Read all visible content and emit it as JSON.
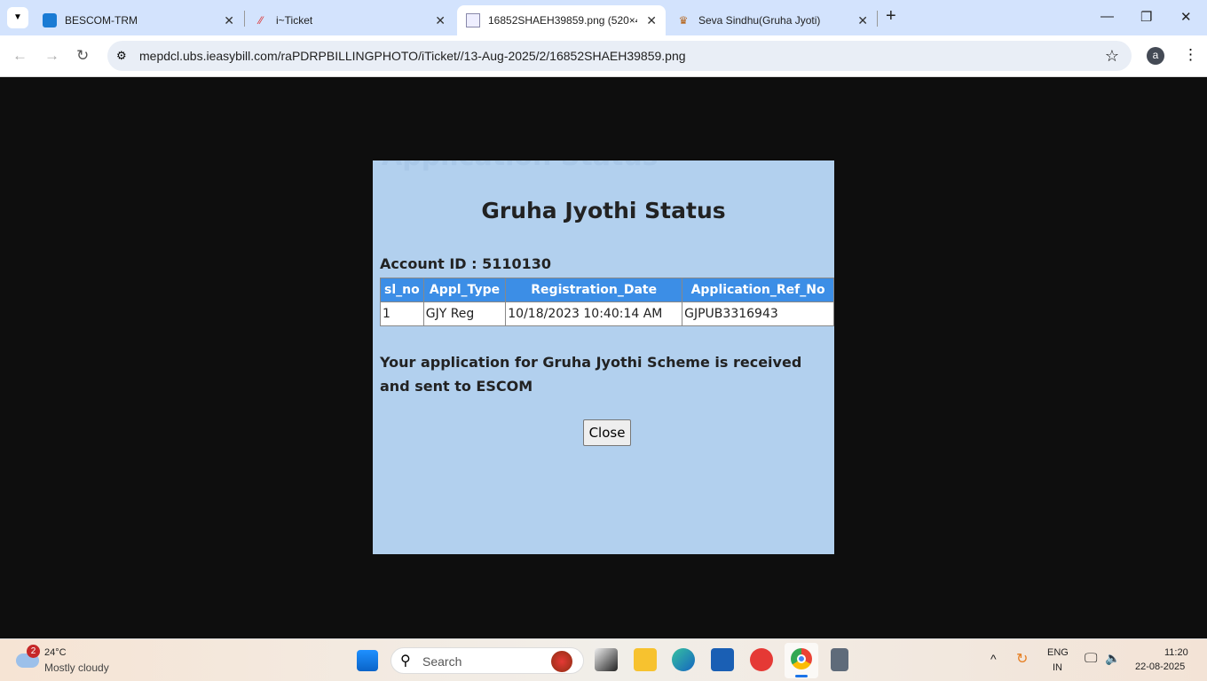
{
  "browser": {
    "tabs": [
      {
        "label": "BESCOM-TRM",
        "icon": "bescom-icon"
      },
      {
        "label": "i~Ticket",
        "icon": "iticket-icon"
      },
      {
        "label": "16852SHAEH39859.png (520×4",
        "icon": "image-file-icon",
        "active": true
      },
      {
        "label": "Seva Sindhu(Gruha Jyoti)",
        "icon": "emblem-icon"
      }
    ],
    "url": "mepdcl.ubs.ieasybill.com/raPDRPBILLINGPHOTO/iTicket//13-Aug-2025/2/16852SHAEH39859.png",
    "profile": "a"
  },
  "page": {
    "ghost_title": "Application Status",
    "title": "Gruha Jyothi Status",
    "account": "Account ID : 5110130",
    "columns": [
      "sl_no",
      "Appl_Type",
      "Registration_Date",
      "Application_Ref_No"
    ],
    "rows": [
      [
        "1",
        "GJY Reg",
        "10/18/2023 10:40:14 AM",
        "GJPUB3316943"
      ]
    ],
    "message": "Your application for Gruha Jyothi Scheme is received and sent to ESCOM",
    "close_label": "Close"
  },
  "taskbar": {
    "weather_badge": "2",
    "temp": "24°C",
    "weather": "Mostly cloudy",
    "search": "Search",
    "lang1": "ENG",
    "lang2": "IN",
    "time": "11:20",
    "date": "22-08-2025"
  }
}
